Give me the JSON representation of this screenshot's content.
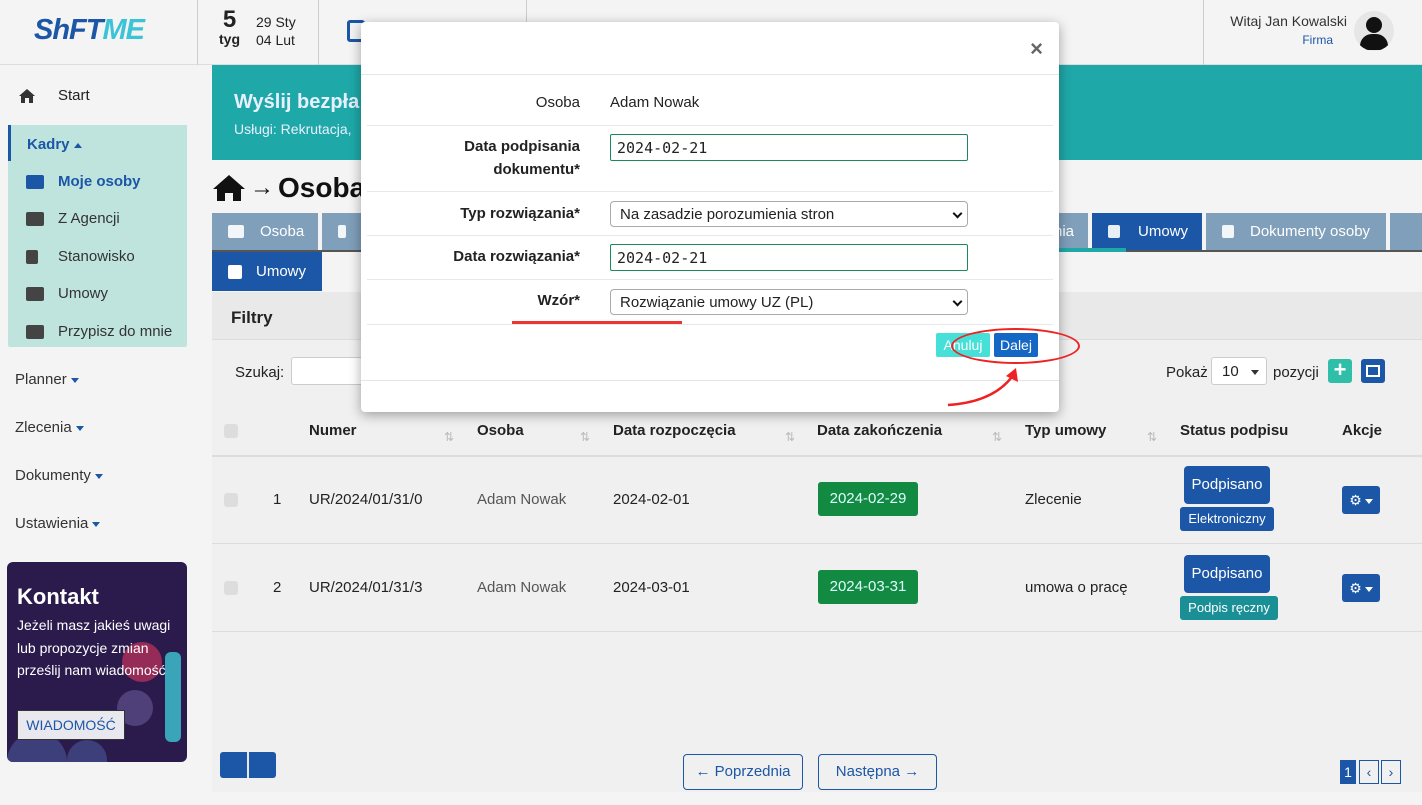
{
  "topbar": {
    "logo_a": "ShFT",
    "logo_b": "ME",
    "week_num": "5",
    "week_label": "tyg",
    "week_start": "29 Sty",
    "week_end": "04 Lut",
    "greeting": "Witaj Jan Kowalski",
    "company": "Firma"
  },
  "sidebar": {
    "start": "Start",
    "kadry": "Kadry",
    "kadry_items": [
      "Moje osoby",
      "Z Agencji",
      "Stanowisko",
      "Umowy",
      "Przypisz do mnie"
    ],
    "planner": "Planner",
    "zlecenia": "Zlecenia",
    "dokumenty": "Dokumenty",
    "ustawienia": "Ustawienia",
    "kontakt_title": "Kontakt",
    "kontakt_text": "Jeżeli masz jakieś uwagi lub propozycje zmian prześlij nam wiadomość",
    "kontakt_button": "WIADOMOŚĆ"
  },
  "banner": {
    "title": "Wyślij bezpła",
    "subtitle": "Usługi: Rekrutacja,"
  },
  "page": {
    "title": "Osoba",
    "tabs": [
      "Osoba",
      "",
      "nia",
      "Umowy",
      "Dokumenty osoby"
    ],
    "subtab": "Umowy",
    "filters": "Filtry",
    "search_label": "Szukaj:",
    "show_label": "Pokaż",
    "show_value": "10",
    "positions_label": "pozycji"
  },
  "table": {
    "headers": [
      "Numer",
      "Osoba",
      "Data rozpoczęcia",
      "Data zakończenia",
      "Typ umowy",
      "Status podpisu",
      "Akcje"
    ],
    "rows": [
      {
        "lp": "1",
        "numer": "UR/2024/01/31/0",
        "osoba": "Adam Nowak",
        "start": "2024-02-01",
        "end": "2024-02-29",
        "typ": "Zlecenie",
        "status": "Podpisano",
        "sign_type": "Elektroniczny"
      },
      {
        "lp": "2",
        "numer": "UR/2024/01/31/3",
        "osoba": "Adam Nowak",
        "start": "2024-03-01",
        "end": "2024-03-31",
        "typ": "umowa o pracę",
        "status": "Podpisano",
        "sign_type": "Podpis ręczny"
      }
    ]
  },
  "pagination": {
    "prev": "Poprzednia",
    "next": "Następna",
    "current": "1"
  },
  "modal": {
    "close": "×",
    "person_label": "Osoba",
    "person_value": "Adam Nowak",
    "sign_date_label_1": "Data podpisania",
    "sign_date_label_2": "dokumentu*",
    "sign_date_value": "2024-02-21",
    "termination_type_label": "Typ rozwiązania*",
    "termination_type_value": "Na zasadzie porozumienia stron",
    "termination_date_label": "Data rozwiązania*",
    "termination_date_value": "2024-02-21",
    "template_label": "Wzór*",
    "template_value": "Rozwiązanie umowy UZ (PL)",
    "cancel": "Anuluj",
    "next": "Dalej"
  },
  "colors": {
    "primary": "#1c56a6",
    "teal": "#1fa8a8",
    "green_badge": "#138a42",
    "annotation": "#e22222"
  }
}
